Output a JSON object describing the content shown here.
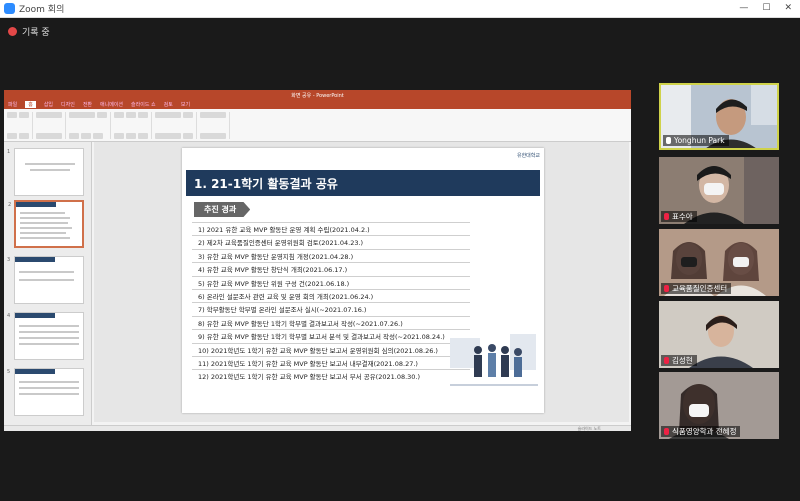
{
  "window": {
    "title": "Zoom 회의"
  },
  "recording": {
    "label": "기록 중"
  },
  "ppt": {
    "title": "화면 공유 - PowerPoint",
    "tabs": [
      "파일",
      "홈",
      "삽입",
      "디자인",
      "전환",
      "애니메이션",
      "슬라이드 쇼",
      "검토",
      "보기"
    ],
    "active_tab": "홈",
    "search_placeholder": "수행할 작업을 알려 주세요",
    "status": "슬라이드 노트"
  },
  "slide": {
    "title": "1. 21-1학기 활동결과 공유",
    "logo": "유한대학교",
    "section_label": "추진 경과",
    "items": [
      "1) 2021 유한 교육 MVP 활동단 운영 계획 수립(2021.04.2.)",
      "2) 제2차 교육품질인증센터 운영위원회 검토(2021.04.23.)",
      "3) 유한 교육 MVP 활동단 운영지침 개정(2021.04.28.)",
      "4) 유한 교육 MVP 활동단 창단식 개최(2021.06.17.)",
      "5) 유한 교육 MVP 활동단 위원 구성 건(2021.06.18.)",
      "6) 온라인 설문조사 관련 교육 및 운영 회의 개최(2021.06.24.)",
      "7) 학부활동단 학부별 온라인 설문조사 실시(~2021.07.16.)",
      "8) 유한 교육 MVP 활동단 1학기 학부별 결과보고서 작성(~2021.07.26.)",
      "9) 유한 교육 MVP 활동단 1학기 학부별 보고서 분석 및 결과보고서 작성(~2021.08.24.)",
      "10) 2021학년도 1학기 유한 교육 MVP 활동단 보고서 운영위원회 심의(2021.08.26.)",
      "11) 2021학년도 1학기 유한 교육 MVP 활동단 보고서 내부결재(2021.08.27.)",
      "12) 2021학년도 1학기 유한 교육 MVP 활동단 보고서 부서 공유(2021.08.30.)"
    ]
  },
  "thumbnails": [
    "1",
    "2",
    "3",
    "4",
    "5"
  ],
  "participants": [
    {
      "name": "Yonghun Park",
      "muted": false,
      "active": true,
      "bg": "#7b8fa6"
    },
    {
      "name": "표수아",
      "muted": true,
      "active": false,
      "bg": "#8c7d72"
    },
    {
      "name": "교육품질인증센터",
      "muted": true,
      "active": false,
      "bg": "#b49a88"
    },
    {
      "name": "김성현",
      "muted": true,
      "active": false,
      "bg": "#d0cbc3"
    },
    {
      "name": "식품영양학과 전혜정",
      "muted": true,
      "active": false,
      "bg": "#a39a95"
    }
  ]
}
